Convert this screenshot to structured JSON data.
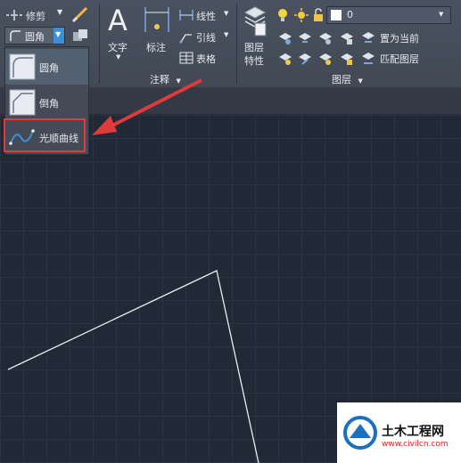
{
  "modify_panel": {
    "trim_label": "修剪",
    "fillet_label": "圆角"
  },
  "fillet_dropdown": {
    "items": [
      {
        "label": "圆角"
      },
      {
        "label": "倒角"
      },
      {
        "label": "光顺曲线"
      }
    ]
  },
  "annotation_panel": {
    "text_label": "文字",
    "dimension_label": "标注",
    "linetype_label": "线性",
    "leader_label": "引线",
    "table_label": "表格",
    "panel_title": "注释"
  },
  "layers_panel": {
    "layer_properties_label_line1": "图层",
    "layer_properties_label_line2": "特性",
    "current_layer": "0",
    "set_current_label": "置为当前",
    "match_layer_label": "匹配图层",
    "panel_title": "图层"
  },
  "watermark": {
    "title": "土木工程网",
    "url": "www.civilcn.com"
  },
  "colors": {
    "ribbon_bg": "#454c58",
    "canvas_bg": "#212836",
    "highlight_red": "#e03b3b",
    "accent_blue": "#3b8fd9"
  }
}
